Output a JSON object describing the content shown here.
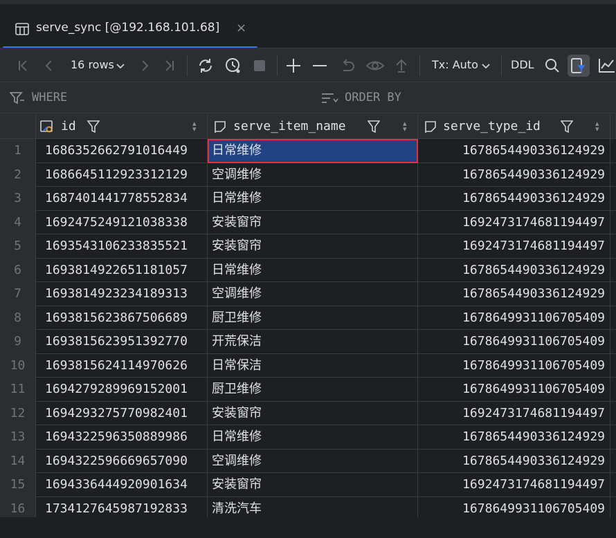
{
  "tab": {
    "title": "serve_sync [@192.168.101.68]",
    "close": "×"
  },
  "toolbar": {
    "rows_label": "16 rows",
    "tx_label": "Tx: Auto",
    "ddl_label": "DDL"
  },
  "filter": {
    "where": "WHERE",
    "order_by": "ORDER BY"
  },
  "columns": [
    {
      "name": "id"
    },
    {
      "name": "serve_item_name"
    },
    {
      "name": "serve_type_id"
    }
  ],
  "rows": [
    {
      "num": "1",
      "id": "1686352662791016449",
      "name": "日常维修",
      "type": "1678654490336124929"
    },
    {
      "num": "2",
      "id": "1686645112923312129",
      "name": "空调维修",
      "type": "1678654490336124929"
    },
    {
      "num": "3",
      "id": "1687401441778552834",
      "name": "日常维修",
      "type": "1678654490336124929"
    },
    {
      "num": "4",
      "id": "1692475249121038338",
      "name": "安装窗帘",
      "type": "1692473174681194497"
    },
    {
      "num": "5",
      "id": "1693543106233835521",
      "name": "安装窗帘",
      "type": "1692473174681194497"
    },
    {
      "num": "6",
      "id": "1693814922651181057",
      "name": "日常维修",
      "type": "1678654490336124929"
    },
    {
      "num": "7",
      "id": "1693814923234189313",
      "name": "空调维修",
      "type": "1678654490336124929"
    },
    {
      "num": "8",
      "id": "1693815623867506689",
      "name": "厨卫维修",
      "type": "1678649931106705409"
    },
    {
      "num": "9",
      "id": "1693815623951392770",
      "name": "开荒保洁",
      "type": "1678649931106705409"
    },
    {
      "num": "10",
      "id": "1693815624114970626",
      "name": "日常保洁",
      "type": "1678649931106705409"
    },
    {
      "num": "11",
      "id": "1694279289969152001",
      "name": "厨卫维修",
      "type": "1678649931106705409"
    },
    {
      "num": "12",
      "id": "1694293275770982401",
      "name": "安装窗帘",
      "type": "1692473174681194497"
    },
    {
      "num": "13",
      "id": "1694322596350889986",
      "name": "日常维修",
      "type": "1678654490336124929"
    },
    {
      "num": "14",
      "id": "1694322596669657090",
      "name": "空调维修",
      "type": "1678654490336124929"
    },
    {
      "num": "15",
      "id": "1694336444920901634",
      "name": "安装窗帘",
      "type": "1692473174681194497"
    },
    {
      "num": "16",
      "id": "1734127645987192833",
      "name": "清洗汽车",
      "type": "1678649931106705409"
    }
  ],
  "selected_row": 0,
  "colors": {
    "accent": "#3574f0",
    "selection": "#214283",
    "highlight_border": "#e0323a"
  }
}
